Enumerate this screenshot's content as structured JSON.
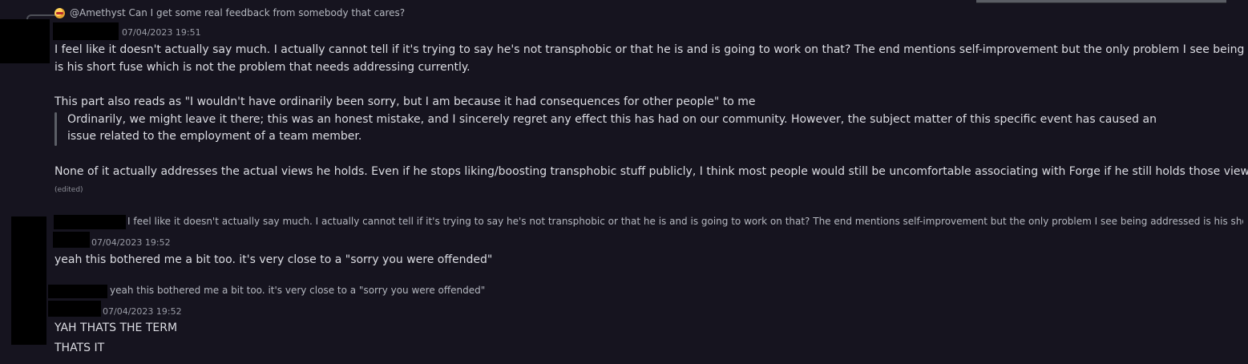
{
  "message1": {
    "reply_preview": "@Amethyst Can I get some real feedback from somebody that cares?",
    "timestamp": "07/04/2023 19:51",
    "lines": [
      "I feel like it doesn't actually say much. I actually cannot tell if it's trying to say he's not transphobic or that he is and is going to work on that? The end mentions self-improvement but the only problem I see being addressed",
      "is his short fuse which is not the problem that needs addressing currently.",
      "This part also reads as \"I wouldn't have ordinarily been sorry, but I am because it had consequences for other people\"  to me",
      "None of it actually addresses the actual views he holds. Even if he stops liking/boosting transphobic stuff publicly, I think most people would still be uncomfortable associating with Forge if he still holds those views silently."
    ],
    "quote_lines": [
      "Ordinarily, we might leave it there; this was an honest mistake, and I sincerely regret any effect this has had on our community. However, the subject matter of this specific event has caused an",
      "issue related to the employment of a team member."
    ],
    "edited_label": "(edited)"
  },
  "message2": {
    "reply_preview": "I feel like it doesn't actually say much. I actually cannot tell if it's trying to say he's not transphobic or that he is and is going to work on that? The end mentions self-improvement but the only problem I see being addressed is his short fuse wl",
    "timestamp": "07/04/2023 19:52",
    "text": "yeah this bothered me a bit too. it's very close to a \"sorry you were offended\""
  },
  "message3": {
    "reply_preview": "yeah this bothered me a bit too. it's very close to a \"sorry you were offended\"",
    "timestamp": "07/04/2023 19:52",
    "lines": [
      "YAH THATS THE TERM",
      "THATS IT"
    ]
  }
}
